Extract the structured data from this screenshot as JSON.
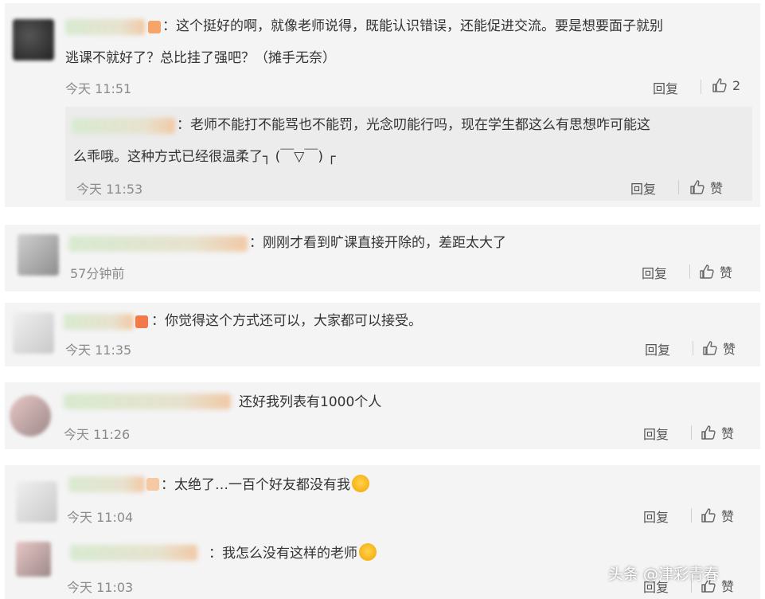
{
  "comments": [
    {
      "text_line1": "：这个挺好的啊，就像老师说得，既能认识错误，还能促进交流。要是想要面子就别",
      "text_line2": "逃课不就好了？总比挂了强吧？（摊手无奈）",
      "time": "今天 11:51",
      "reply": "回复",
      "like": "2",
      "sub": {
        "text_line1": "：老师不能打不能骂也不能罚，光念叨能行吗，现在学生都这么有思想咋可能这",
        "text_line2": "么乖哦。这种方式已经很温柔了┐ (￣▽￣) ┌",
        "time": "今天 11:53",
        "reply": "回复",
        "like": "赞"
      }
    },
    {
      "text": "：刚刚才看到旷课直接开除的，差距太大了",
      "time": "57分钟前",
      "reply": "回复",
      "like": "赞"
    },
    {
      "text": "：你觉得这个方式还可以，大家都可以接受。",
      "time": "今天 11:35",
      "reply": "回复",
      "like": "赞"
    },
    {
      "text": "还好我列表有1000个人",
      "time": "今天 11:26",
      "reply": "回复",
      "like": "赞"
    },
    {
      "text": "：太绝了…一百个好友都没有我",
      "time": "今天 11:04",
      "reply": "回复",
      "like": "赞",
      "sub": {
        "text": "：我怎么没有这样的老师",
        "time": "今天 11:03",
        "reply": "回复",
        "like": "赞"
      }
    }
  ],
  "watermark": "头条 @津彩青春",
  "colors": {
    "card_bg": "#f4f4f4",
    "subcard_bg": "#ececec",
    "time": "#8a8a8a"
  },
  "icons": {
    "like": "thumbs-up-icon",
    "avatar": "user-avatar-blurred"
  }
}
